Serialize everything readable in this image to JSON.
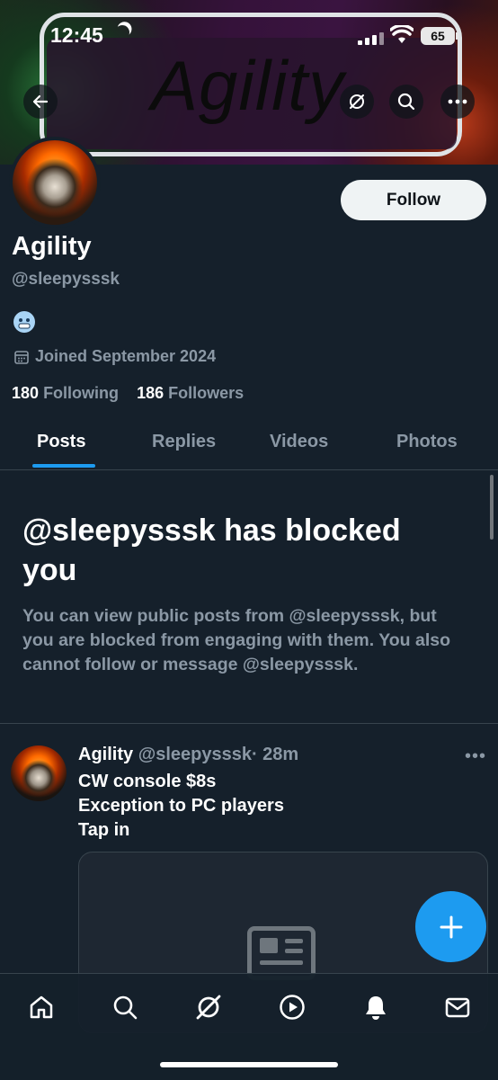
{
  "status_bar": {
    "time": "12:45",
    "battery": "65"
  },
  "banner": {
    "text": "Agility"
  },
  "profile": {
    "follow_label": "Follow",
    "name": "Agility",
    "handle": "@sleepysssk",
    "joined": "Joined September 2024",
    "following_count": "180",
    "following_label": "Following",
    "followers_count": "186",
    "followers_label": "Followers"
  },
  "tabs": [
    {
      "label": "Posts",
      "active": true
    },
    {
      "label": "Replies",
      "active": false
    },
    {
      "label": "Videos",
      "active": false
    },
    {
      "label": "Photos",
      "active": false
    }
  ],
  "blocked": {
    "title": "@sleepysssk has blocked you",
    "description": "You can view public posts from @sleepysssk, but you are blocked from engaging with them. You also cannot follow or message @sleepysssk."
  },
  "post": {
    "author": "Agility",
    "handle": "@sleepysssk",
    "time": "· 28m",
    "lines": [
      "CW console $8s",
      "Exception to PC players",
      "Tap in"
    ]
  },
  "colors": {
    "accent": "#1d9bf0",
    "background": "#15202b",
    "muted": "#8b98a5"
  }
}
